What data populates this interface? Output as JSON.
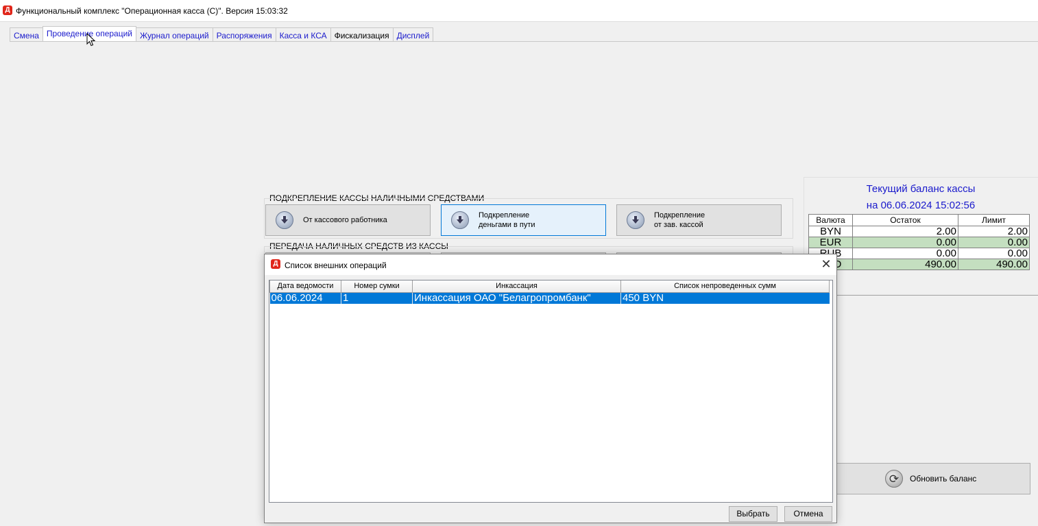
{
  "window": {
    "title": "Функциональный комплекс \"Операционная касса (С)\". Версия  15:03:32"
  },
  "tabs": [
    {
      "label": "Смена"
    },
    {
      "label": "Проведение операций"
    },
    {
      "label": "Журнал операций"
    },
    {
      "label": "Распоряжения"
    },
    {
      "label": "Касса и КСА"
    },
    {
      "label": "Фискализация"
    },
    {
      "label": "Дисплей"
    }
  ],
  "groups": {
    "reinforcement": {
      "header": "ПОДКРЕПЛЕНИЕ КАССЫ НАЛИЧНЫМИ СРЕДСТВАМИ",
      "buttons": [
        {
          "label": "От кассового работника"
        },
        {
          "label": "Подкрепление\nденьгами в пути"
        },
        {
          "label": "Подкрепление\nот зав. кассой"
        }
      ]
    },
    "transfer": {
      "header": "ПЕРЕДАЧА НАЛИЧНЫХ СРЕДСТВ ИЗ КАССЫ"
    }
  },
  "balance": {
    "title_line1": "Текущий баланс кассы",
    "title_line2": "на 06.06.2024 15:02:56",
    "columns": [
      "Валюта",
      "Остаток",
      "Лимит"
    ],
    "rows": [
      {
        "currency": "BYN",
        "rest": "2.00",
        "limit": "2.00"
      },
      {
        "currency": "EUR",
        "rest": "0.00",
        "limit": "0.00"
      },
      {
        "currency": "RUB",
        "rest": "0.00",
        "limit": "0.00"
      },
      {
        "currency": "USD",
        "rest": "490.00",
        "limit": "490.00"
      }
    ],
    "refresh_label": "Обновить баланс"
  },
  "dialog": {
    "title": "Список внешних операций",
    "columns": [
      "Дата ведомости",
      "Номер сумки",
      "Инкассация",
      "Список непроведенных сумм"
    ],
    "rows": [
      {
        "date": "06.06.2024",
        "bag": "1",
        "collection": "Инкассация ОАО \"Белагропромбанк\"",
        "amounts": "450 BYN"
      }
    ],
    "ok_label": "Выбрать",
    "cancel_label": "Отмена"
  },
  "colors": {
    "accent": "#0078d7",
    "link_blue": "#1a1acc",
    "balance_green": "#c4dfc0",
    "logo_red": "#e0261a"
  }
}
